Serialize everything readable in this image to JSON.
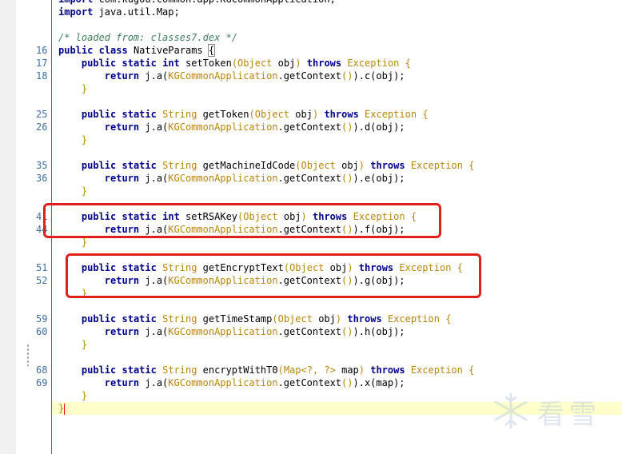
{
  "editor": {
    "lines": [
      {
        "ln": "",
        "text": "import com.kugou.common.app.KGCommonApplication;",
        "kind": "import"
      },
      {
        "ln": "",
        "text": "import java.util.Map;",
        "kind": "import2"
      },
      {
        "ln": "",
        "text": "",
        "kind": "blank"
      },
      {
        "ln": "",
        "text": "/* loaded from: classes7.dex */",
        "kind": "comment"
      },
      {
        "ln": "16",
        "text": "public class NativeParams {",
        "kind": "class"
      },
      {
        "ln": "17",
        "kind": "method",
        "rtype": "int",
        "name": "setToken",
        "params": "Object obj"
      },
      {
        "ln": "18",
        "kind": "ret",
        "call": "c",
        "arg": "obj"
      },
      {
        "ln": "",
        "text": "    }",
        "kind": "close"
      },
      {
        "ln": "",
        "text": "",
        "kind": "blank"
      },
      {
        "ln": "25",
        "kind": "method",
        "rtype": "String",
        "name": "getToken",
        "params": "Object obj"
      },
      {
        "ln": "26",
        "kind": "ret",
        "call": "d",
        "arg": "obj"
      },
      {
        "ln": "",
        "text": "    }",
        "kind": "close"
      },
      {
        "ln": "",
        "text": "",
        "kind": "blank"
      },
      {
        "ln": "35",
        "kind": "method",
        "rtype": "String",
        "name": "getMachineIdCode",
        "params": "Object obj"
      },
      {
        "ln": "36",
        "kind": "ret",
        "call": "e",
        "arg": "obj"
      },
      {
        "ln": "",
        "text": "    }",
        "kind": "close"
      },
      {
        "ln": "",
        "text": "",
        "kind": "blank"
      },
      {
        "ln": "41",
        "kind": "method",
        "rtype": "int",
        "name": "setRSAKey",
        "params": "Object obj"
      },
      {
        "ln": "44",
        "kind": "ret",
        "call": "f",
        "arg": "obj"
      },
      {
        "ln": "",
        "text": "    }",
        "kind": "close"
      },
      {
        "ln": "",
        "text": "",
        "kind": "blank"
      },
      {
        "ln": "51",
        "kind": "method",
        "rtype": "String",
        "name": "getEncryptText",
        "params": "Object obj"
      },
      {
        "ln": "52",
        "kind": "ret",
        "call": "g",
        "arg": "obj"
      },
      {
        "ln": "",
        "text": "    }",
        "kind": "close"
      },
      {
        "ln": "",
        "text": "",
        "kind": "blank"
      },
      {
        "ln": "59",
        "kind": "method",
        "rtype": "String",
        "name": "getTimeStamp",
        "params": "Object obj"
      },
      {
        "ln": "60",
        "kind": "ret",
        "call": "h",
        "arg": "obj"
      },
      {
        "ln": "",
        "text": "    }",
        "kind": "close"
      },
      {
        "ln": "",
        "text": "",
        "kind": "blank"
      },
      {
        "ln": "68",
        "kind": "method",
        "rtype": "String",
        "name": "encryptWithT0",
        "params": "Map<?, ?> map"
      },
      {
        "ln": "69",
        "kind": "ret",
        "call": "x",
        "arg": "map"
      },
      {
        "ln": "",
        "text": "    }",
        "kind": "close"
      },
      {
        "ln": "",
        "text": "}",
        "kind": "endclass"
      }
    ]
  },
  "tokens": {
    "public": "public",
    "static": "static",
    "class": "class",
    "return": "return",
    "throws": "throws",
    "exception": "Exception",
    "object": "Object",
    "map": "Map",
    "context_call": "j.a(KGCommonApplication.getContext())"
  },
  "watermark": {
    "text": "看雪",
    "icon": "snowflake-icon"
  },
  "colors": {
    "highlight_box": "#e0201b",
    "current_line": "#ffffcc",
    "keyword": "#00008b",
    "type": "#b8860b",
    "comment": "#3f7f5f"
  }
}
